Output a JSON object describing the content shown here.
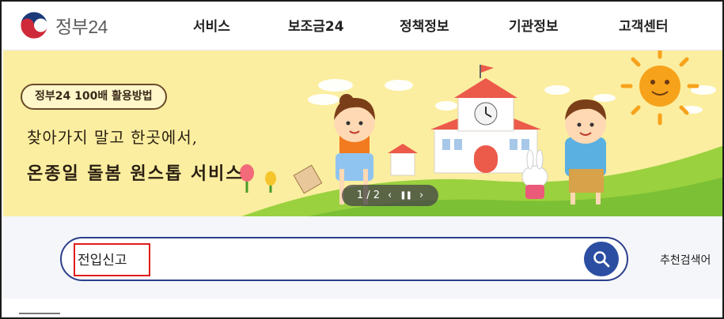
{
  "logo": {
    "text": "정부24",
    "mark_icon": "taegeuk-logo-icon"
  },
  "nav": {
    "items": [
      {
        "label": "서비스"
      },
      {
        "label": "보조금24"
      },
      {
        "label": "정책정보"
      },
      {
        "label": "기관정보"
      },
      {
        "label": "고객센터"
      }
    ]
  },
  "banner": {
    "pill_label": "정부24 100배 활용방법",
    "headline_line1": "찾아가지 말고 한곳에서,",
    "headline_line2": "온종일 돌봄 원스톱 서비스",
    "pager": {
      "current": "1 / 2",
      "prev_icon": "chevron-left-icon",
      "pause_icon": "pause-icon",
      "next_icon": "chevron-right-icon"
    }
  },
  "search": {
    "value": "전입신고",
    "button_icon": "search-icon",
    "recommended_label": "추천검색어"
  },
  "colors": {
    "banner_bg": "#fbeea0",
    "search_border": "#2c3f8a",
    "search_button": "#2b4ea2",
    "highlight": "#e11b1b"
  }
}
